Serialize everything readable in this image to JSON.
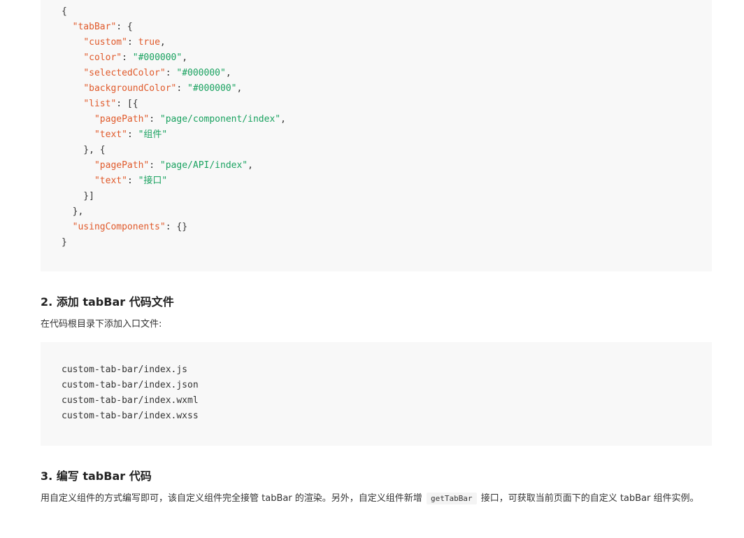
{
  "json_code_block": {
    "lines": [
      [
        [
          "punc",
          "{"
        ]
      ],
      [
        [
          "punc",
          "  "
        ],
        [
          "key",
          "\"tabBar\""
        ],
        [
          "punc",
          ": {"
        ]
      ],
      [
        [
          "punc",
          "    "
        ],
        [
          "key",
          "\"custom\""
        ],
        [
          "punc",
          ": "
        ],
        [
          "kw",
          "true"
        ],
        [
          "punc",
          ","
        ]
      ],
      [
        [
          "punc",
          "    "
        ],
        [
          "key",
          "\"color\""
        ],
        [
          "punc",
          ": "
        ],
        [
          "str",
          "\"#000000\""
        ],
        [
          "punc",
          ","
        ]
      ],
      [
        [
          "punc",
          "    "
        ],
        [
          "key",
          "\"selectedColor\""
        ],
        [
          "punc",
          ": "
        ],
        [
          "str",
          "\"#000000\""
        ],
        [
          "punc",
          ","
        ]
      ],
      [
        [
          "punc",
          "    "
        ],
        [
          "key",
          "\"backgroundColor\""
        ],
        [
          "punc",
          ": "
        ],
        [
          "str",
          "\"#000000\""
        ],
        [
          "punc",
          ","
        ]
      ],
      [
        [
          "punc",
          "    "
        ],
        [
          "key",
          "\"list\""
        ],
        [
          "punc",
          ": [{"
        ]
      ],
      [
        [
          "punc",
          "      "
        ],
        [
          "key",
          "\"pagePath\""
        ],
        [
          "punc",
          ": "
        ],
        [
          "str",
          "\"page/component/index\""
        ],
        [
          "punc",
          ","
        ]
      ],
      [
        [
          "punc",
          "      "
        ],
        [
          "key",
          "\"text\""
        ],
        [
          "punc",
          ": "
        ],
        [
          "str",
          "\"组件\""
        ]
      ],
      [
        [
          "punc",
          "    }, {"
        ]
      ],
      [
        [
          "punc",
          "      "
        ],
        [
          "key",
          "\"pagePath\""
        ],
        [
          "punc",
          ": "
        ],
        [
          "str",
          "\"page/API/index\""
        ],
        [
          "punc",
          ","
        ]
      ],
      [
        [
          "punc",
          "      "
        ],
        [
          "key",
          "\"text\""
        ],
        [
          "punc",
          ": "
        ],
        [
          "str",
          "\"接口\""
        ]
      ],
      [
        [
          "punc",
          "    }]"
        ]
      ],
      [
        [
          "punc",
          "  },"
        ]
      ],
      [
        [
          "punc",
          "  "
        ],
        [
          "key",
          "\"usingComponents\""
        ],
        [
          "punc",
          ": {}"
        ]
      ],
      [
        [
          "punc",
          "}"
        ]
      ]
    ]
  },
  "section2": {
    "heading": "2. 添加 tabBar 代码文件",
    "description": "在代码根目录下添加入口文件:",
    "code_lines": [
      "custom-tab-bar/index.js",
      "custom-tab-bar/index.json",
      "custom-tab-bar/index.wxml",
      "custom-tab-bar/index.wxss"
    ]
  },
  "section3": {
    "heading": "3. 编写 tabBar 代码",
    "text_before": "用自定义组件的方式编写即可，该自定义组件完全接管 tabBar 的渲染。另外，自定义组件新增 ",
    "inline_code": "getTabBar",
    "text_after": " 接口，可获取当前页面下的自定义 tabBar 组件实例。"
  },
  "colors": {
    "code_background": "#f8f8f8",
    "json_key": "#e05a2b",
    "json_string": "#1aa260",
    "text": "#333333"
  }
}
